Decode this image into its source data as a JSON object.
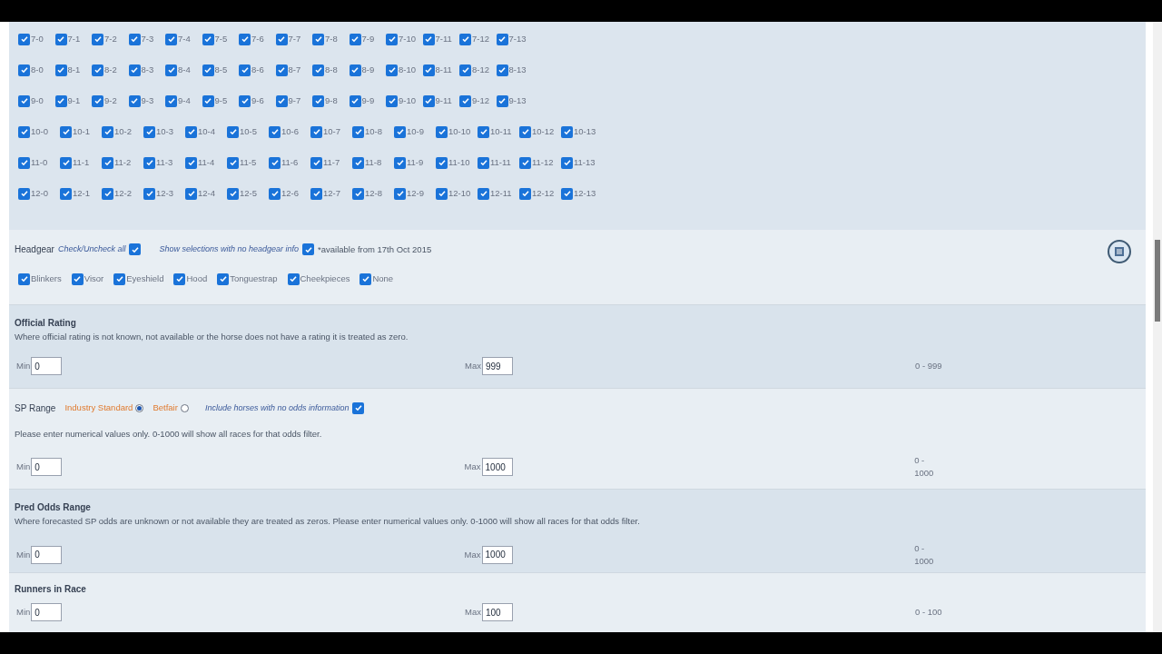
{
  "weight": {
    "rows": [
      {
        "options": [
          {
            "label": "7-0",
            "checked": true
          },
          {
            "label": "7-1",
            "checked": true
          },
          {
            "label": "7-2",
            "checked": true
          },
          {
            "label": "7-3",
            "checked": true
          },
          {
            "label": "7-4",
            "checked": true
          },
          {
            "label": "7-5",
            "checked": true
          },
          {
            "label": "7-6",
            "checked": true
          },
          {
            "label": "7-7",
            "checked": true
          },
          {
            "label": "7-8",
            "checked": true
          },
          {
            "label": "7-9",
            "checked": true
          },
          {
            "label": "7-10",
            "checked": true
          },
          {
            "label": "7-11",
            "checked": true
          },
          {
            "label": "7-12",
            "checked": true
          },
          {
            "label": "7-13",
            "checked": true
          }
        ]
      },
      {
        "options": [
          {
            "label": "8-0",
            "checked": true
          },
          {
            "label": "8-1",
            "checked": true
          },
          {
            "label": "8-2",
            "checked": true
          },
          {
            "label": "8-3",
            "checked": true
          },
          {
            "label": "8-4",
            "checked": true
          },
          {
            "label": "8-5",
            "checked": true
          },
          {
            "label": "8-6",
            "checked": true
          },
          {
            "label": "8-7",
            "checked": true
          },
          {
            "label": "8-8",
            "checked": true
          },
          {
            "label": "8-9",
            "checked": true
          },
          {
            "label": "8-10",
            "checked": true
          },
          {
            "label": "8-11",
            "checked": true
          },
          {
            "label": "8-12",
            "checked": true
          },
          {
            "label": "8-13",
            "checked": true
          }
        ]
      },
      {
        "options": [
          {
            "label": "9-0",
            "checked": true
          },
          {
            "label": "9-1",
            "checked": true
          },
          {
            "label": "9-2",
            "checked": true
          },
          {
            "label": "9-3",
            "checked": true
          },
          {
            "label": "9-4",
            "checked": true
          },
          {
            "label": "9-5",
            "checked": true
          },
          {
            "label": "9-6",
            "checked": true
          },
          {
            "label": "9-7",
            "checked": true
          },
          {
            "label": "9-8",
            "checked": true
          },
          {
            "label": "9-9",
            "checked": true
          },
          {
            "label": "9-10",
            "checked": true
          },
          {
            "label": "9-11",
            "checked": true
          },
          {
            "label": "9-12",
            "checked": true
          },
          {
            "label": "9-13",
            "checked": true
          }
        ]
      },
      {
        "options": [
          {
            "label": "10-0",
            "checked": true
          },
          {
            "label": "10-1",
            "checked": true
          },
          {
            "label": "10-2",
            "checked": true
          },
          {
            "label": "10-3",
            "checked": true
          },
          {
            "label": "10-4",
            "checked": true
          },
          {
            "label": "10-5",
            "checked": true
          },
          {
            "label": "10-6",
            "checked": true
          },
          {
            "label": "10-7",
            "checked": true
          },
          {
            "label": "10-8",
            "checked": true
          },
          {
            "label": "10-9",
            "checked": true
          },
          {
            "label": "10-10",
            "checked": true
          },
          {
            "label": "10-11",
            "checked": true
          },
          {
            "label": "10-12",
            "checked": true
          },
          {
            "label": "10-13",
            "checked": true
          }
        ]
      },
      {
        "options": [
          {
            "label": "11-0",
            "checked": true
          },
          {
            "label": "11-1",
            "checked": true
          },
          {
            "label": "11-2",
            "checked": true
          },
          {
            "label": "11-3",
            "checked": true
          },
          {
            "label": "11-4",
            "checked": true
          },
          {
            "label": "11-5",
            "checked": true
          },
          {
            "label": "11-6",
            "checked": true
          },
          {
            "label": "11-7",
            "checked": true
          },
          {
            "label": "11-8",
            "checked": true
          },
          {
            "label": "11-9",
            "checked": true
          },
          {
            "label": "11-10",
            "checked": true
          },
          {
            "label": "11-11",
            "checked": true
          },
          {
            "label": "11-12",
            "checked": true
          },
          {
            "label": "11-13",
            "checked": true
          }
        ]
      },
      {
        "options": [
          {
            "label": "12-0",
            "checked": true
          },
          {
            "label": "12-1",
            "checked": true
          },
          {
            "label": "12-2",
            "checked": true
          },
          {
            "label": "12-3",
            "checked": true
          },
          {
            "label": "12-4",
            "checked": true
          },
          {
            "label": "12-5",
            "checked": true
          },
          {
            "label": "12-6",
            "checked": true
          },
          {
            "label": "12-7",
            "checked": true
          },
          {
            "label": "12-8",
            "checked": true
          },
          {
            "label": "12-9",
            "checked": true
          },
          {
            "label": "12-10",
            "checked": true
          },
          {
            "label": "12-11",
            "checked": true
          },
          {
            "label": "12-12",
            "checked": true
          },
          {
            "label": "12-13",
            "checked": true
          }
        ]
      }
    ]
  },
  "headgear": {
    "title": "Headgear",
    "check_all": {
      "label": "Check/Uncheck all",
      "checked": true
    },
    "no_info": {
      "label": "Show selections with no headgear info",
      "checked": true
    },
    "note": "*available from 17th Oct 2015",
    "options": [
      {
        "label": "Blinkers",
        "checked": true
      },
      {
        "label": "Visor",
        "checked": true
      },
      {
        "label": "Eyeshield",
        "checked": true
      },
      {
        "label": "Hood",
        "checked": true
      },
      {
        "label": "Tonguestrap",
        "checked": true
      },
      {
        "label": "Cheekpieces",
        "checked": true
      },
      {
        "label": "None",
        "checked": true
      }
    ]
  },
  "ranges": [
    {
      "kind": "plain",
      "title": "Official Rating",
      "description": "Where official rating is not known, not available or the horse does not have a rating it is treated as zero.",
      "min_label": "Min",
      "min": "0",
      "max_label": "Max",
      "max": "999",
      "span": "0 - 999"
    },
    {
      "kind": "sp",
      "title": "SP Range",
      "sources": [
        {
          "label": "Industry Standard",
          "selected": true
        },
        {
          "label": "Betfair",
          "selected": false
        }
      ],
      "no_odds": {
        "label": "Include horses with no odds information",
        "checked": true
      },
      "description": "Please enter numerical values only. 0-1000 will show all races for that odds filter.",
      "min_label": "Min",
      "min": "0",
      "max_label": "Max",
      "max": "1000",
      "span": "0 - 1000"
    },
    {
      "kind": "plain",
      "title": "Pred Odds Range",
      "description": "Where forecasted SP odds are unknown or not available they are treated as zeros. Please enter numerical values only. 0-1000 will show all races for that odds filter.",
      "min_label": "Min",
      "min": "0",
      "max_label": "Max",
      "max": "1000",
      "span": "0 - 1000"
    },
    {
      "kind": "plain",
      "title": "Runners in Race",
      "min_label": "Min",
      "min": "0",
      "max_label": "Max",
      "max": "100",
      "span": "0 - 100"
    }
  ]
}
